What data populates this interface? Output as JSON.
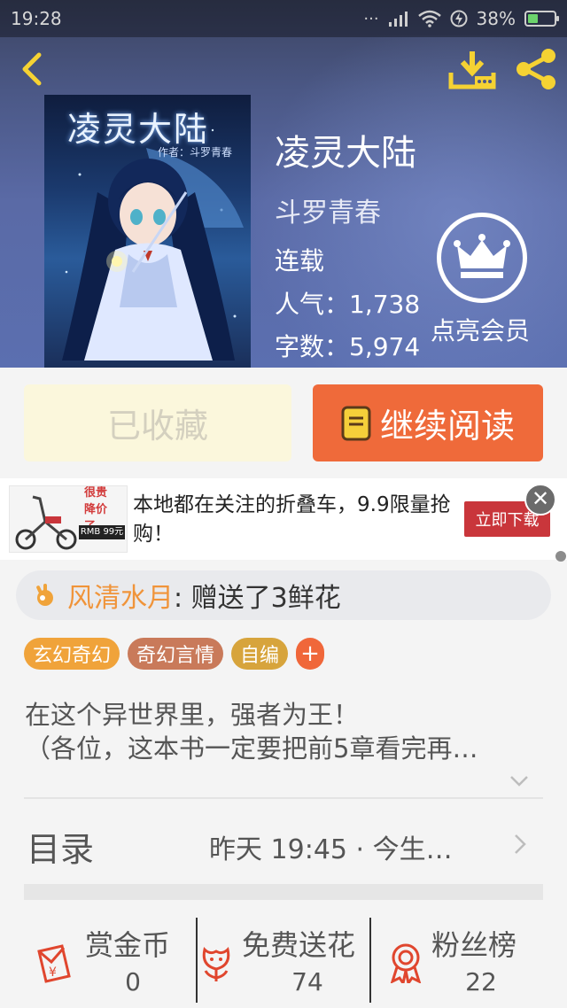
{
  "status_bar": {
    "time": "19:28",
    "battery": "38%"
  },
  "book": {
    "cover_title": "凌灵大陆",
    "cover_subtitle": "作者：斗罗青春",
    "title": "凌灵大陆",
    "author": "斗罗青春",
    "status": "连载",
    "popularity": "人气：1,738",
    "word_count": "字数：5,974"
  },
  "vip": {
    "label": "点亮会员"
  },
  "actions": {
    "collected_label": "已收藏",
    "continue_label": "继续阅读"
  },
  "ad": {
    "image_tag": "很贵降价了",
    "image_price": "RMB 99元",
    "text": "本地都在关注的折叠车，9.9限量抢购！",
    "button_label": "立即下载"
  },
  "gift": {
    "user": "风清水月",
    "action": ": 赠送了3鲜花"
  },
  "tags": [
    {
      "label": "玄幻奇幻",
      "color": "#f0a33a"
    },
    {
      "label": "奇幻言情",
      "color": "#c97a5a"
    },
    {
      "label": "自编",
      "color": "#d7a43c"
    }
  ],
  "tag_add_label": "+",
  "description": {
    "line1": "在这个异世界里，强者为王！",
    "line2": "（各位，这本书一定要把前5章看完再…"
  },
  "toc": {
    "label": "目录",
    "update": "昨天 19:45 · 今生…"
  },
  "stats": [
    {
      "label": "赏金币",
      "value": "0",
      "icon": "red-envelope-icon"
    },
    {
      "label": "免费送花",
      "value": "74",
      "icon": "flower-icon"
    },
    {
      "label": "粉丝榜",
      "value": "22",
      "icon": "medal-icon"
    }
  ],
  "colors": {
    "accent": "#ef6a3a",
    "gift_user": "#f0943a",
    "ad_button": "#c9363b"
  }
}
